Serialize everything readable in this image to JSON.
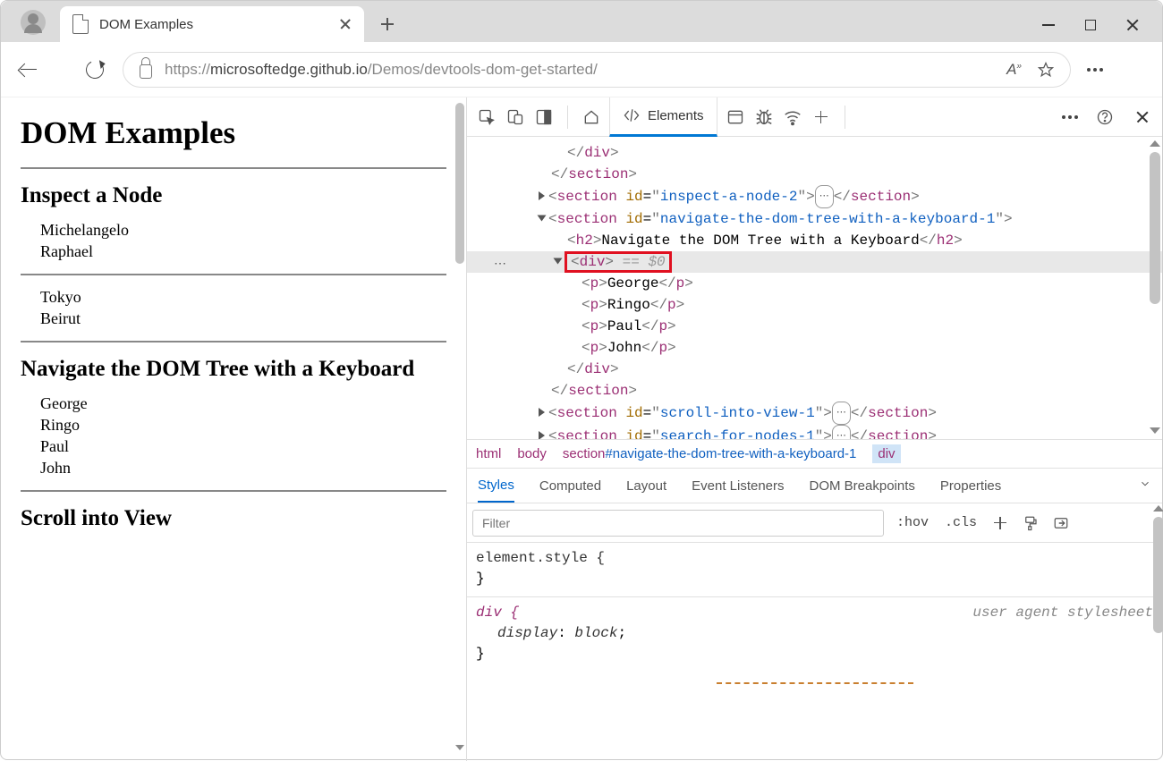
{
  "browser": {
    "tab_title": "DOM Examples",
    "url_prefix": "https://",
    "url_host": "microsoftedge.github.io",
    "url_path": "/Demos/devtools-dom-get-started/"
  },
  "page": {
    "h1": "DOM Examples",
    "sec1_h2": "Inspect a Node",
    "sec1_items": [
      "Michelangelo",
      "Raphael"
    ],
    "sec1b_items": [
      "Tokyo",
      "Beirut"
    ],
    "sec2_h2": "Navigate the DOM Tree with a Keyboard",
    "sec2_items": [
      "George",
      "Ringo",
      "Paul",
      "John"
    ],
    "sec3_h2": "Scroll into View"
  },
  "devtools": {
    "elements_label": "Elements",
    "dom": {
      "close_div": "</div>",
      "close_section": "</section>",
      "inspect2": {
        "tag": "section",
        "id": "inspect-a-node-2"
      },
      "nav": {
        "tag": "section",
        "id": "navigate-the-dom-tree-with-a-keyboard-1",
        "h2": "Navigate the DOM Tree with a Keyboard"
      },
      "selected": {
        "tag": "div",
        "annotation": "== $0"
      },
      "children": [
        "George",
        "Ringo",
        "Paul",
        "John"
      ],
      "scroll": {
        "tag": "section",
        "id": "scroll-into-view-1"
      },
      "search": {
        "tag": "section",
        "id": "search-for-nodes-1"
      }
    },
    "breadcrumb": {
      "b0": "html",
      "b1": "body",
      "b2_tag": "section",
      "b2_id": "#navigate-the-dom-tree-with-a-keyboard-1",
      "b3": "div"
    },
    "styles_tabs": {
      "styles": "Styles",
      "computed": "Computed",
      "layout": "Layout",
      "events": "Event Listeners",
      "dombp": "DOM Breakpoints",
      "props": "Properties"
    },
    "filter_placeholder": "Filter",
    "filter_btns": {
      "hov": ":hov",
      "cls": ".cls"
    },
    "rules": {
      "element_sel": "element.style {",
      "element_close": "}",
      "div_sel": "div {",
      "div_prop_name": "display",
      "div_prop_val": "block",
      "div_prop_punct": ": ",
      "div_close": "}",
      "origin": "user agent stylesheet"
    }
  }
}
